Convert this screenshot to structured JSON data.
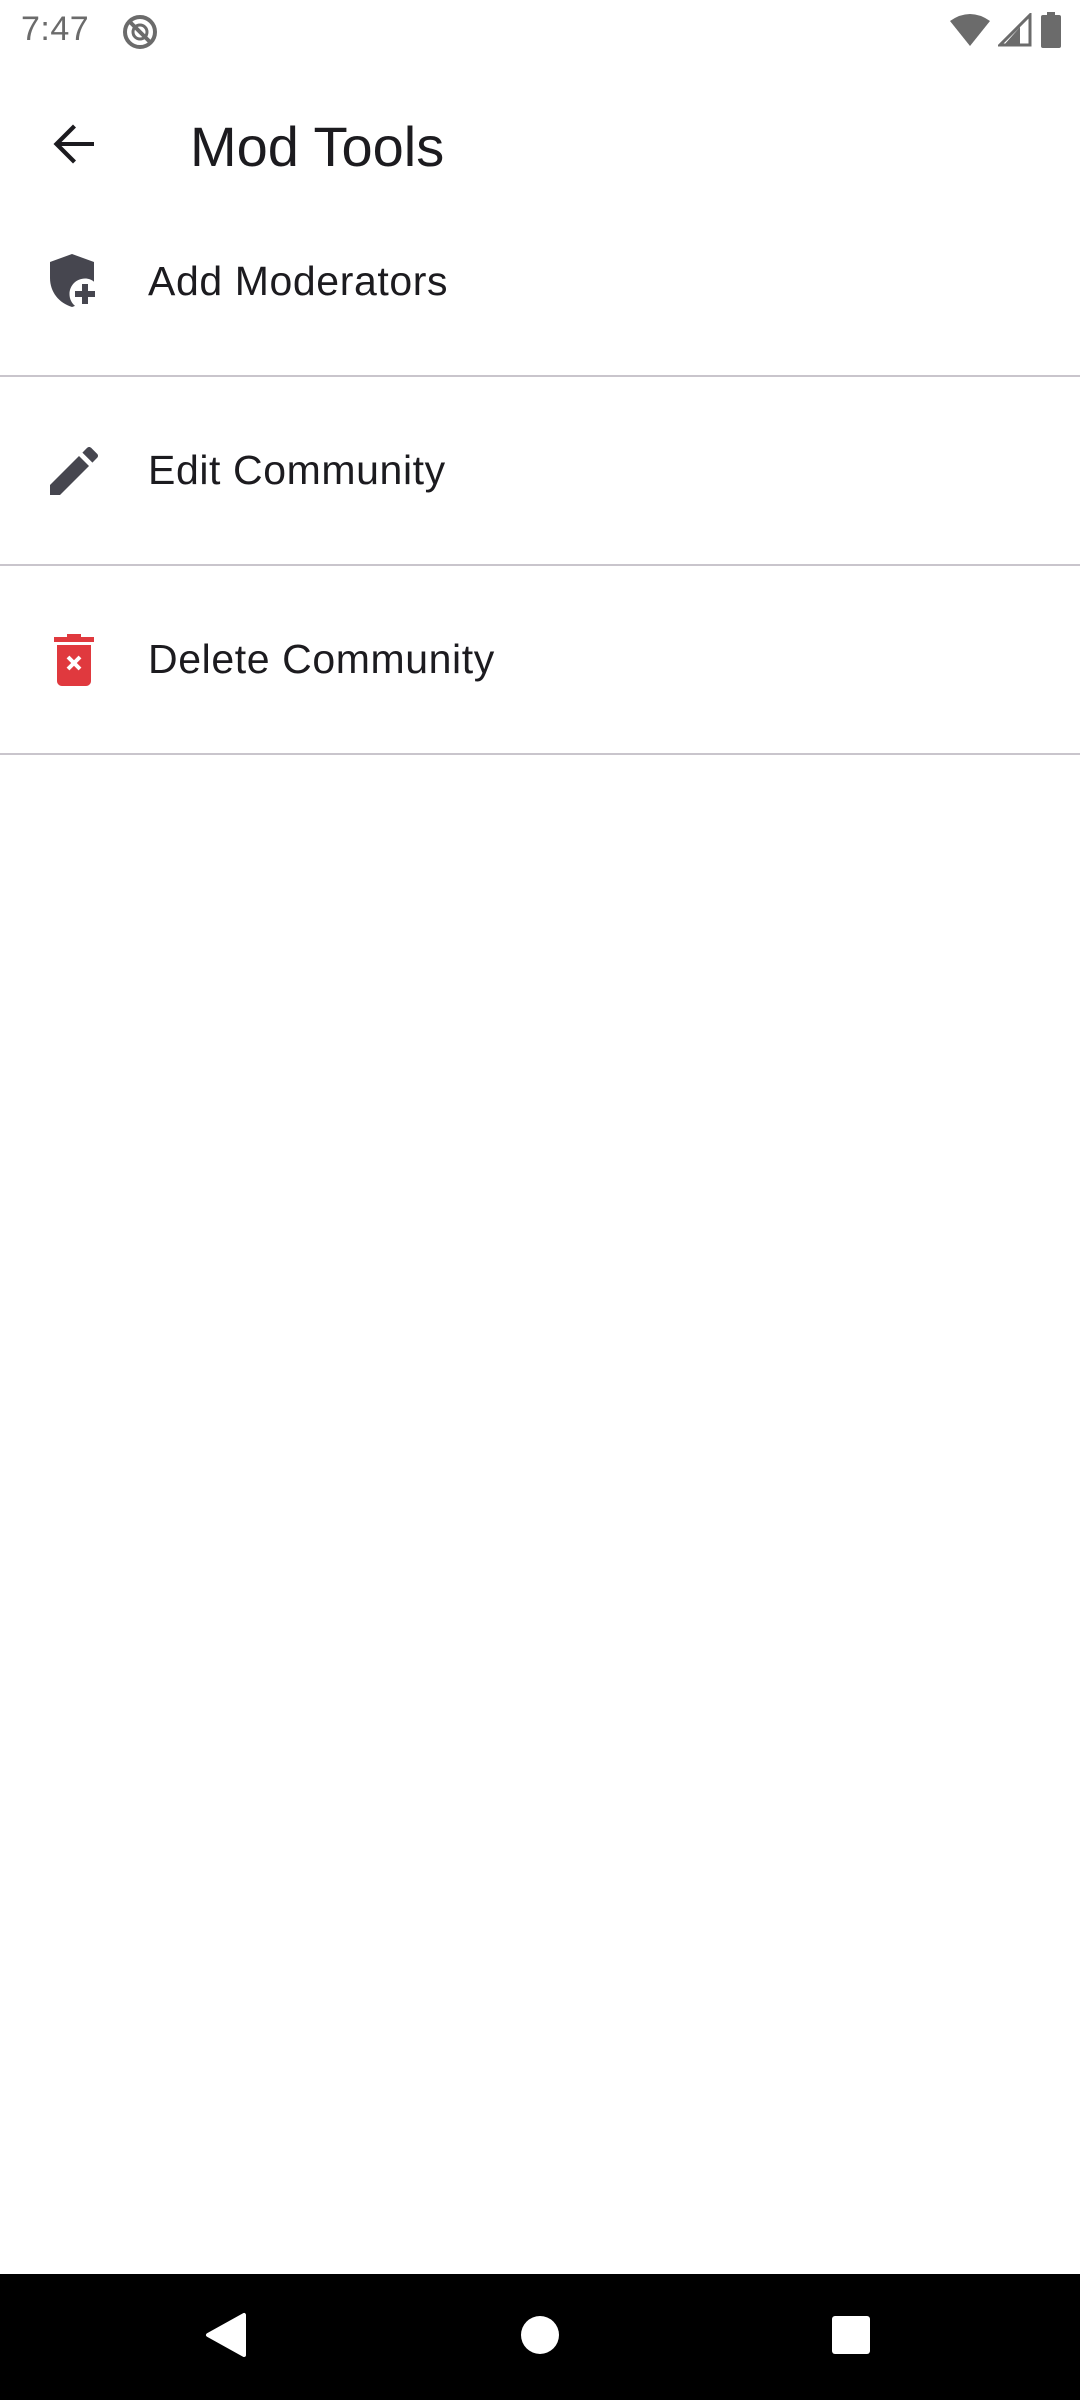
{
  "status_bar": {
    "time": "7:47",
    "icons": [
      "do-not-disturb-icon",
      "wifi-icon",
      "cell-signal-icon",
      "battery-icon"
    ]
  },
  "app_bar": {
    "back_icon": "arrow-back-icon",
    "title": "Mod Tools"
  },
  "tools": [
    {
      "label": "Add Moderators",
      "icon": "shield-add-icon",
      "icon_color": "#46464f"
    },
    {
      "label": "Edit Community",
      "icon": "pencil-icon",
      "icon_color": "#46464f"
    },
    {
      "label": "Delete Community",
      "icon": "trash-x-icon",
      "icon_color": "#e0393e"
    }
  ],
  "nav_bar": {
    "back": "nav-back-icon",
    "home": "nav-home-icon",
    "recents": "nav-recents-icon"
  },
  "colors": {
    "text": "#1c1b1f",
    "icon_gray": "#46464f",
    "danger": "#e0393e",
    "divider": "#c9c5cc",
    "nav_background": "#000000"
  }
}
